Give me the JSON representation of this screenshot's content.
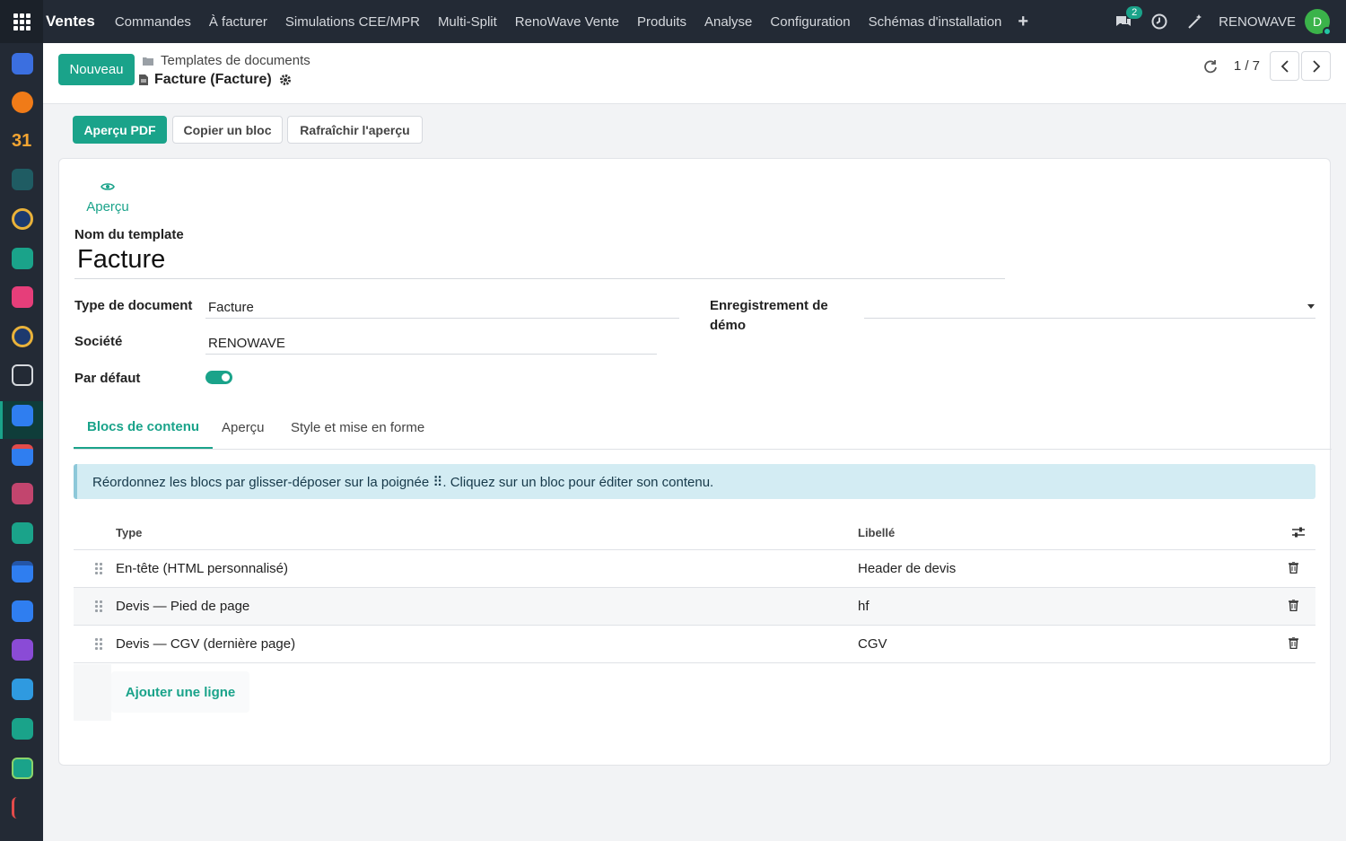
{
  "topbar": {
    "brand": "Ventes",
    "menu": [
      "Commandes",
      "À facturer",
      "Simulations CEE/MPR",
      "Multi-Split",
      "RenoWave Vente",
      "Produits",
      "Analyse",
      "Configuration",
      "Schémas d'installation"
    ],
    "plus": "+",
    "messages_count": "2",
    "company": "RENOWAVE",
    "avatar_initial": "D"
  },
  "control_panel": {
    "new_button": "Nouveau",
    "breadcrumb_parent": "Templates de documents",
    "breadcrumb_current": "Facture (Facture)",
    "pager": "1 / 7"
  },
  "statusbar": {
    "buttons": [
      "Aperçu PDF",
      "Copier un bloc",
      "Rafraîchir l'aperçu"
    ]
  },
  "form": {
    "smart_button": "Aperçu",
    "name_label": "Nom du template",
    "name_value": "Facture",
    "doc_type_label": "Type de document",
    "doc_type_value": "Facture",
    "company_label": "Société",
    "company_value": "RENOWAVE",
    "default_label": "Par défaut",
    "default_value": true,
    "demo_label_line1": "Enregistrement de",
    "demo_label_line2": "démo",
    "demo_value": ""
  },
  "tabs": [
    "Blocs de contenu",
    "Aperçu",
    "Style et mise en forme"
  ],
  "alert": "Réordonnez les blocs par glisser-déposer sur la poignée ⠿. Cliquez sur un bloc pour éditer son contenu.",
  "table": {
    "columns": [
      "Type",
      "Libellé"
    ],
    "rows": [
      {
        "type": "En-tête (HTML personnalisé)",
        "label": "Header de devis"
      },
      {
        "type": "Devis — Pied de page",
        "label": "hf"
      },
      {
        "type": "Devis — CGV (dernière page)",
        "label": "CGV"
      }
    ],
    "add_line": "Ajouter une ligne"
  },
  "colors": {
    "accent": "#1aa38a",
    "navbar": "#232a35"
  }
}
